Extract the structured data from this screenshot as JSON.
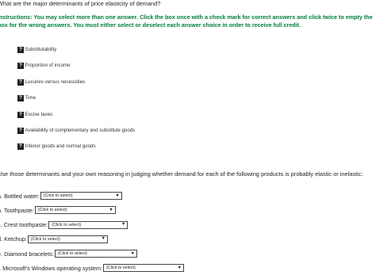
{
  "question": "What are the major determinants of price elasticity of demand?",
  "instructions": "Instructions: You may select more than one answer. Click the box once with a check mark for correct answers and click twice to empty the box for the wrong answers.  You must either select or deselect each answer choice in order to receive full credit.",
  "choices": [
    {
      "icon": "?",
      "label": "Substitutability"
    },
    {
      "icon": "?",
      "label": "Proportion of income"
    },
    {
      "icon": "?",
      "label": "Luxuries versus necessities"
    },
    {
      "icon": "?",
      "label": "Time"
    },
    {
      "icon": "?",
      "label": "Excise taxes"
    },
    {
      "icon": "?",
      "label": "Availability of complementary and substitute goods"
    },
    {
      "icon": "?",
      "label": "Inferior goods and normal goods"
    }
  ],
  "intro2": "Use those determinants and your own reasoning in judging whether demand for each of the following products is probably elastic or inelastic:",
  "products": [
    {
      "label": "a. Bottled water:",
      "select": "(Click to select)"
    },
    {
      "label": "b. Toothpaste:",
      "select": "(Click to select)"
    },
    {
      "label": "c. Crest toothpaste:",
      "select": "(Click to select)"
    },
    {
      "label": "d. Ketchup:",
      "select": "(Click to select)"
    },
    {
      "label": "e. Diamond bracelets:",
      "select": "(Click to select)"
    },
    {
      "label": "f. Microsoft's Windows operating system:",
      "select": "(Click to select)"
    }
  ],
  "dropdown_arrow": "▼"
}
